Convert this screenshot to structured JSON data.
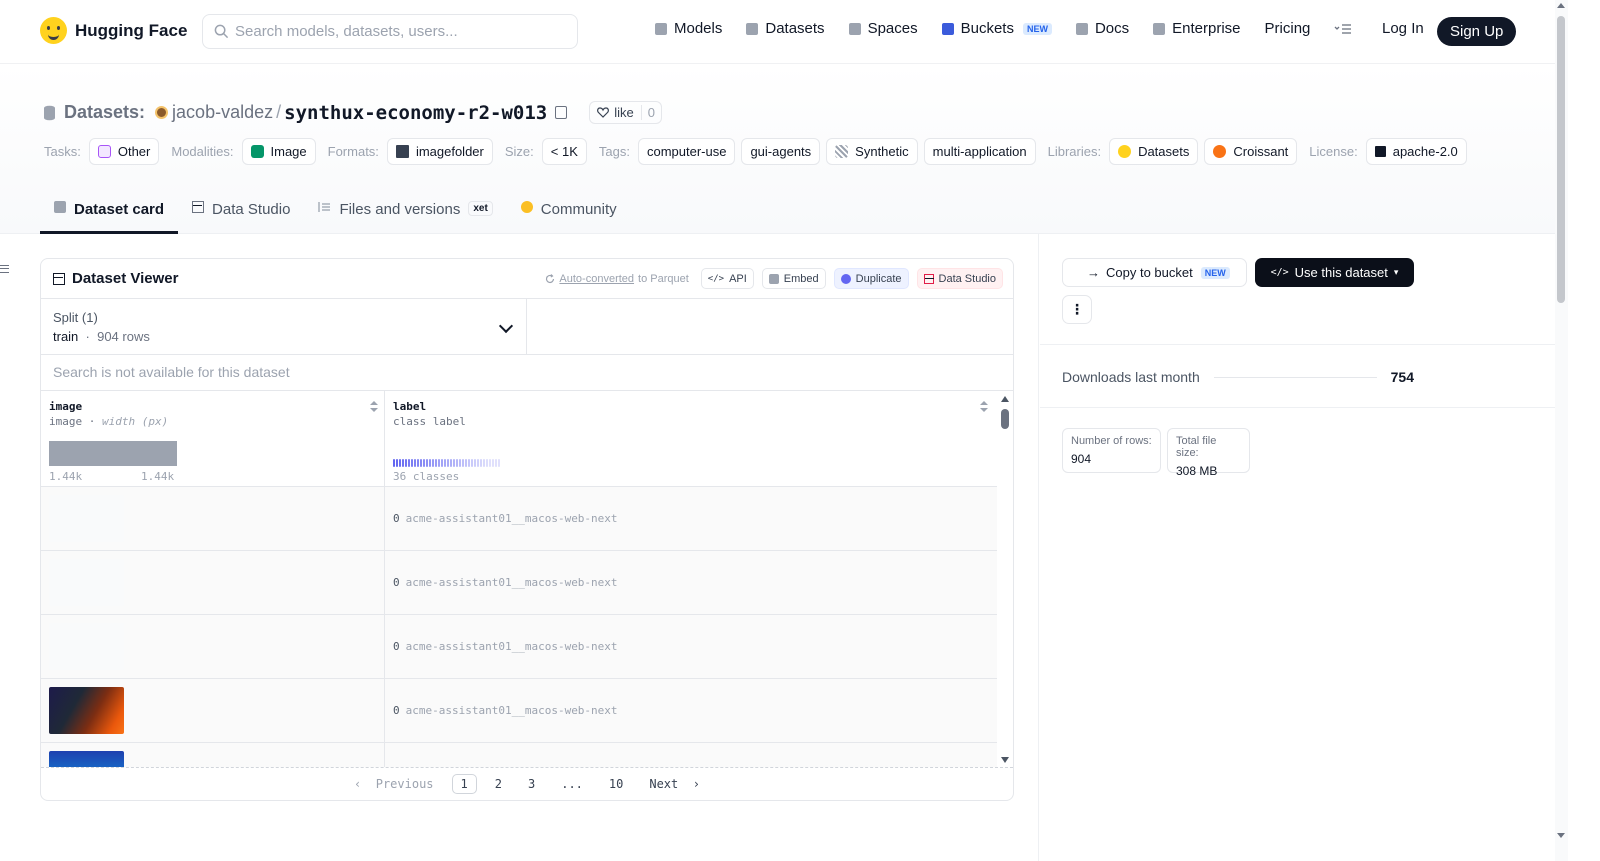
{
  "nav": {
    "brand": "Hugging Face",
    "search_placeholder": "Search models, datasets, users...",
    "links": [
      {
        "label": "Models",
        "icon": "cube-icon"
      },
      {
        "label": "Datasets",
        "icon": "database-icon"
      },
      {
        "label": "Spaces",
        "icon": "grid-icon"
      },
      {
        "label": "Buckets",
        "icon": "bucket-icon",
        "badge": "NEW"
      },
      {
        "label": "Docs",
        "icon": "book-icon"
      },
      {
        "label": "Enterprise",
        "icon": "building-icon"
      },
      {
        "label": "Pricing"
      }
    ],
    "login": "Log In",
    "signup": "Sign Up"
  },
  "header": {
    "section": "Datasets:",
    "owner": "jacob-valdez",
    "sep": "/",
    "dataset": "synthux-economy-r2-w013",
    "like": "like",
    "likes": "0"
  },
  "tags": {
    "tasks_label": "Tasks:",
    "tasks": "Other",
    "modalities_label": "Modalities:",
    "modalities": "Image",
    "formats_label": "Formats:",
    "formats": "imagefolder",
    "size_label": "Size:",
    "size": "< 1K",
    "tags_label": "Tags:",
    "tag_list": [
      "computer-use",
      "gui-agents",
      "Synthetic",
      "multi-application"
    ],
    "libraries_label": "Libraries:",
    "libraries": [
      "Datasets",
      "Croissant"
    ],
    "license_label": "License:",
    "license": "apache-2.0"
  },
  "tabs": {
    "card": "Dataset card",
    "studio": "Data Studio",
    "files": "Files and versions",
    "xet": "xet",
    "community": "Community"
  },
  "viewer": {
    "title": "Dataset Viewer",
    "autoconv": "Auto-converted",
    "autoconv_suffix": "to Parquet",
    "api": "API",
    "embed": "Embed",
    "duplicate": "Duplicate",
    "data_studio": "Data Studio",
    "split_label": "Split (1)",
    "split_name": "train",
    "split_rows": "904 rows",
    "search_na": "Search is not available for this dataset",
    "col1_name": "image",
    "col1_type": "image",
    "col1_sub": "width (px)",
    "col1_min": "1.44k",
    "col1_max": "1.44k",
    "col2_name": "label",
    "col2_type": "class label",
    "col2_classes": "36 classes",
    "rows": [
      {
        "idx": "0",
        "label": "acme-assistant01__macos-web-next",
        "thumb": "blank"
      },
      {
        "idx": "0",
        "label": "acme-assistant01__macos-web-next",
        "thumb": "blank"
      },
      {
        "idx": "0",
        "label": "acme-assistant01__macos-web-next",
        "thumb": "blank"
      },
      {
        "idx": "0",
        "label": "acme-assistant01__macos-web-next",
        "thumb": "dark"
      }
    ],
    "pager": {
      "prev": "Previous",
      "pages": [
        "1",
        "2",
        "3",
        "...",
        "10"
      ],
      "next": "Next"
    }
  },
  "side": {
    "copy_bucket": "Copy to bucket",
    "copy_badge": "NEW",
    "use_dataset": "Use this dataset",
    "downloads_label": "Downloads last month",
    "downloads": "754",
    "rows_label": "Number of rows:",
    "rows": "904",
    "size_label": "Total file size:",
    "size": "308 MB"
  }
}
